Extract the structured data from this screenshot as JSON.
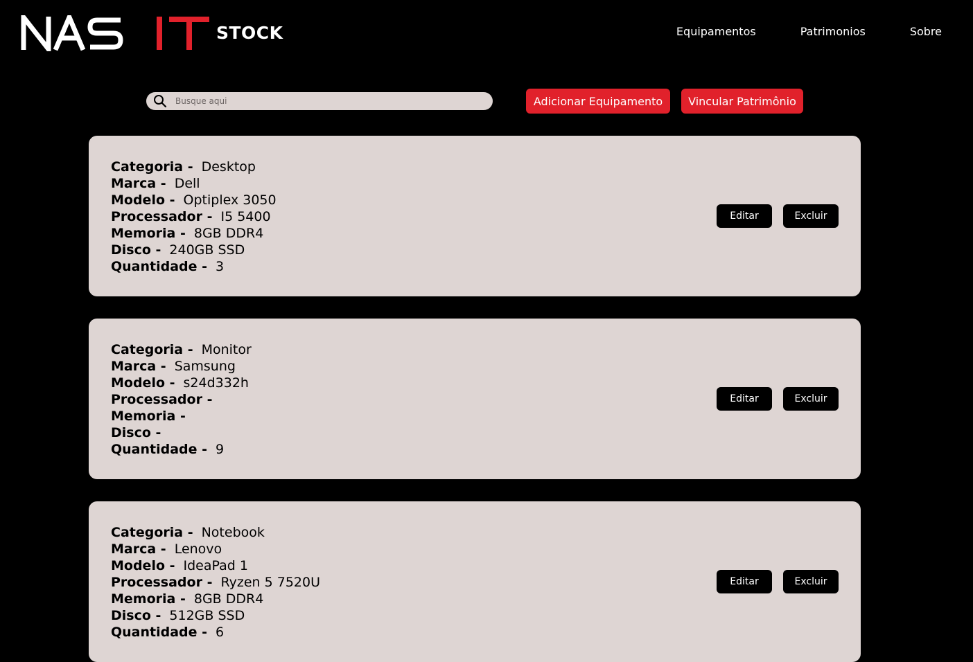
{
  "header": {
    "logo_text": "NASIT",
    "logo_sub": "STOCK",
    "nav": [
      {
        "label": "Equipamentos"
      },
      {
        "label": "Patrimonios"
      },
      {
        "label": "Sobre"
      }
    ]
  },
  "toolbar": {
    "search_placeholder": "Busque aqui",
    "add_label": "Adicionar Equipamento",
    "link_label": "Vincular Patrimônio"
  },
  "labels": {
    "categoria": "Categoria -",
    "marca": "Marca -",
    "modelo": "Modelo -",
    "processador": "Processador -",
    "memoria": "Memoria -",
    "disco": "Disco -",
    "quantidade": "Quantidade -",
    "edit": "Editar",
    "delete": "Excluir"
  },
  "items": [
    {
      "categoria": "Desktop",
      "marca": "Dell",
      "modelo": "Optiplex 3050",
      "processador": "I5 5400",
      "memoria": "8GB DDR4",
      "disco": "240GB SSD",
      "quantidade": "3"
    },
    {
      "categoria": "Monitor",
      "marca": "Samsung",
      "modelo": "s24d332h",
      "processador": "",
      "memoria": "",
      "disco": "",
      "quantidade": "9"
    },
    {
      "categoria": "Notebook",
      "marca": "Lenovo",
      "modelo": "IdeaPad 1",
      "processador": "Ryzen 5 7520U",
      "memoria": "8GB DDR4",
      "disco": "512GB SSD",
      "quantidade": "6"
    }
  ],
  "colors": {
    "accent": "#e1212b",
    "card_bg": "#ded5d3",
    "background": "#000000"
  }
}
